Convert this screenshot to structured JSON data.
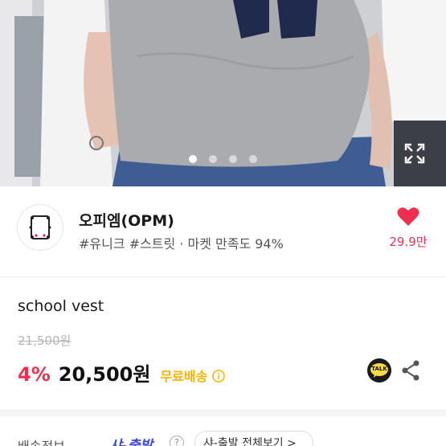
{
  "gallery": {
    "slides_total": 4,
    "active_slide": 1,
    "expand_icon": "expand-icon"
  },
  "store": {
    "name": "오피엠(OPM)",
    "tags": "#유니크 #스트릿 · 마켓 만족도 94%",
    "like_count": "29.9만",
    "like_icon": "heart-icon",
    "accent_color": "#ef2f4f"
  },
  "product": {
    "title": "school vest",
    "original_price": "21,500원",
    "discount": "4%",
    "price": "20,500원",
    "shipping": "무료배송",
    "shipping_color": "#f5b400"
  },
  "actions": {
    "talk_label": "TALK",
    "share_icon": "share-icon"
  },
  "delivery": {
    "label": "배송정보",
    "tag": "샤-출발",
    "help": "?",
    "more": "샤-출발 전체보기 >"
  }
}
